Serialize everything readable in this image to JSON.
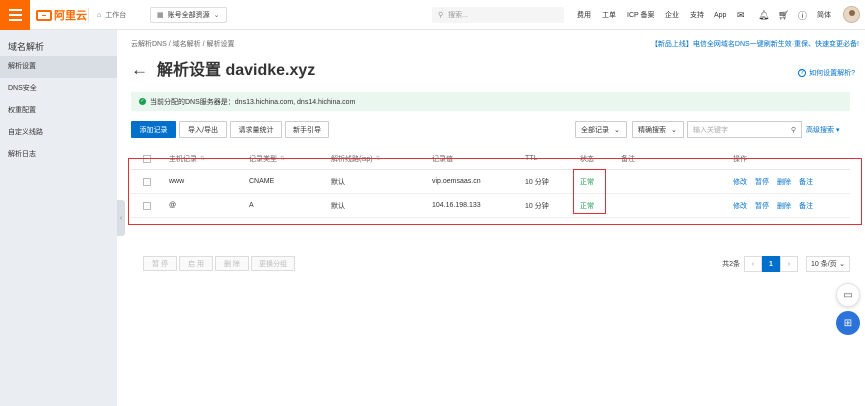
{
  "topbar": {
    "logo_text": "阿里云",
    "workbench": "工作台",
    "resource_selector": "账号全部资源",
    "search_placeholder": "搜索...",
    "nav": [
      "费用",
      "工单",
      "ICP 备案",
      "企业",
      "支持",
      "App"
    ],
    "lang": "简体"
  },
  "sidebar": {
    "title": "域名解析",
    "items": [
      {
        "label": "解析设置",
        "active": true
      },
      {
        "label": "DNS安全",
        "active": false
      },
      {
        "label": "权重配置",
        "active": false
      },
      {
        "label": "自定义线路",
        "active": false
      },
      {
        "label": "解析日志",
        "active": false
      }
    ]
  },
  "breadcrumb": {
    "a": "云解析DNS",
    "b": "域名解析",
    "c": "解析设置",
    "sep": "/"
  },
  "notice": "【新品上线】电信全网域名DNS一键刷新生效·重保、快速变更必备!",
  "page_title": "解析设置 davidke.xyz",
  "help_link": "如何设置解析?",
  "alert": "当前分配的DNS服务器是：dns13.hichina.com, dns14.hichina.com",
  "toolbar": {
    "add": "添加记录",
    "import": "导入/导出",
    "stats": "请求量统计",
    "guide": "新手引导",
    "all_records": "全部记录",
    "exact": "精确搜索",
    "keyword_placeholder": "输入关键字",
    "advanced": "高级搜索"
  },
  "table": {
    "headers": [
      "主机记录",
      "记录类型",
      "解析线路(isp)",
      "记录值",
      "TTL",
      "状态",
      "备注",
      "操作"
    ],
    "rows": [
      {
        "host": "www",
        "type": "CNAME",
        "line": "默认",
        "value": "vip.oemsaas.cn",
        "ttl": "10 分钟",
        "status": "正常"
      },
      {
        "host": "@",
        "type": "A",
        "line": "默认",
        "value": "104.16.198.133",
        "ttl": "10 分钟",
        "status": "正常"
      }
    ],
    "actions": [
      "修改",
      "暂停",
      "删除",
      "备注"
    ]
  },
  "footer": {
    "buttons": [
      "暂 停",
      "启 用",
      "删 除",
      "更换分组"
    ],
    "total": "共2条",
    "current_page": "1",
    "per_page": "10 条/页"
  },
  "colors": {
    "accent": "#0070cc",
    "brand": "#ff6a00",
    "ok": "#1a9e4f",
    "highlight": "#e0303a"
  }
}
